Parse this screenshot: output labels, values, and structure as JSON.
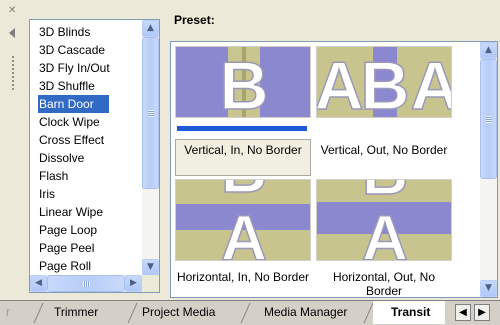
{
  "transitions": {
    "items": [
      "3D Blinds",
      "3D Cascade",
      "3D Fly In/Out",
      "3D Shuffle",
      "Barn Door",
      "Clock Wipe",
      "Cross Effect",
      "Dissolve",
      "Flash",
      "Iris",
      "Linear Wipe",
      "Page Loop",
      "Page Peel",
      "Page Roll"
    ],
    "selected": "Barn Door"
  },
  "preset": {
    "label": "Preset:",
    "tiles": [
      {
        "caption": "Vertical, In, No Border",
        "selected": true
      },
      {
        "caption": "Vertical, Out, No Border",
        "selected": false
      },
      {
        "caption": "Horizontal, In, No Border",
        "selected": false
      },
      {
        "caption": "Horizontal, Out, No Border",
        "selected": false
      }
    ]
  },
  "tabs": [
    {
      "label": "r"
    },
    {
      "label": "Trimmer"
    },
    {
      "label": "Project Media"
    },
    {
      "label": "Media Manager"
    },
    {
      "label": "Transit",
      "active": true
    }
  ],
  "icons": {
    "close": "close-icon",
    "collapse": "arrow-left-icon",
    "grip": "grip-icon"
  },
  "colors": {
    "selection": "#316ac5",
    "preset_selected_bar": "#1a5ad7",
    "tile_purple": "#8b88cf",
    "tile_yellow": "#c8c48e"
  }
}
